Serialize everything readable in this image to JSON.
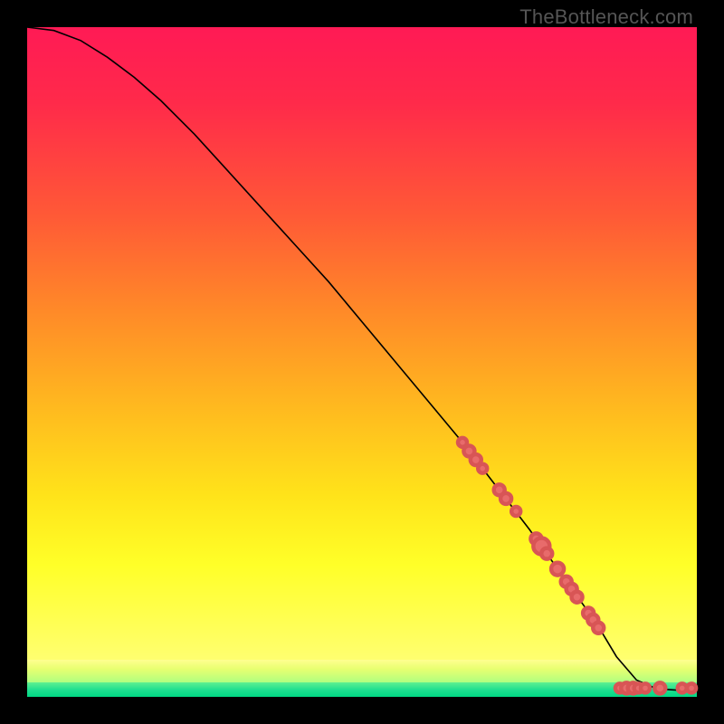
{
  "watermark": "TheBottleneck.com",
  "chart_data": {
    "type": "line",
    "title": "",
    "xlabel": "",
    "ylabel": "",
    "xlim": [
      0,
      100
    ],
    "ylim": [
      0,
      100
    ],
    "curve": {
      "x": [
        0,
        4,
        8,
        12,
        16,
        20,
        25,
        30,
        35,
        40,
        45,
        50,
        55,
        60,
        65,
        70,
        75,
        80,
        85,
        88,
        91,
        94,
        97,
        100
      ],
      "y": [
        100,
        99.5,
        98,
        95.5,
        92.5,
        89,
        84,
        78.5,
        73,
        67.5,
        62,
        56,
        50,
        44,
        38,
        31.5,
        25,
        18,
        11,
        6,
        2.5,
        1.2,
        1.0,
        1.0
      ]
    },
    "series": [
      {
        "name": "highlight-points",
        "marker": "circle",
        "color": "#e86b6b",
        "points": [
          {
            "x": 65.0,
            "y": 38.0,
            "r": 5
          },
          {
            "x": 66.0,
            "y": 36.7,
            "r": 6
          },
          {
            "x": 67.0,
            "y": 35.4,
            "r": 6
          },
          {
            "x": 68.0,
            "y": 34.1,
            "r": 5
          },
          {
            "x": 70.5,
            "y": 30.9,
            "r": 6
          },
          {
            "x": 71.5,
            "y": 29.6,
            "r": 6
          },
          {
            "x": 73.0,
            "y": 27.7,
            "r": 5
          },
          {
            "x": 76.0,
            "y": 23.6,
            "r": 6
          },
          {
            "x": 76.8,
            "y": 22.5,
            "r": 9
          },
          {
            "x": 77.6,
            "y": 21.4,
            "r": 6
          },
          {
            "x": 79.2,
            "y": 19.1,
            "r": 7
          },
          {
            "x": 80.5,
            "y": 17.2,
            "r": 6
          },
          {
            "x": 81.3,
            "y": 16.1,
            "r": 6
          },
          {
            "x": 82.1,
            "y": 14.9,
            "r": 6
          },
          {
            "x": 83.8,
            "y": 12.5,
            "r": 6
          },
          {
            "x": 84.5,
            "y": 11.5,
            "r": 6
          },
          {
            "x": 85.3,
            "y": 10.3,
            "r": 6
          },
          {
            "x": 88.5,
            "y": 1.3,
            "r": 5
          },
          {
            "x": 89.5,
            "y": 1.3,
            "r": 6
          },
          {
            "x": 90.5,
            "y": 1.3,
            "r": 6
          },
          {
            "x": 91.3,
            "y": 1.3,
            "r": 5
          },
          {
            "x": 92.3,
            "y": 1.3,
            "r": 5
          },
          {
            "x": 94.5,
            "y": 1.3,
            "r": 6
          },
          {
            "x": 97.8,
            "y": 1.3,
            "r": 5
          },
          {
            "x": 99.2,
            "y": 1.3,
            "r": 5
          }
        ]
      }
    ]
  }
}
